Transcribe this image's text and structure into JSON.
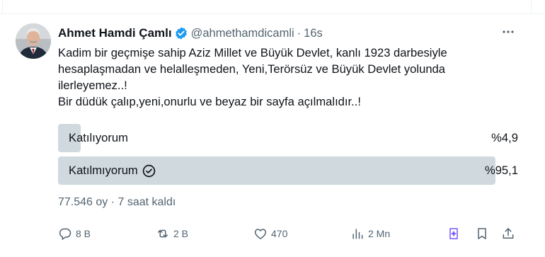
{
  "author": {
    "name": "Ahmet Hamdi Çamlı",
    "handle": "@ahmethamdicamli",
    "separator": "·",
    "time": "16s"
  },
  "tweet_lines": [
    "Kadim bir geçmişe sahip Aziz Millet  ve Büyük Devlet, kanlı 1923 darbesiyle",
    "hesaplaşmadan ve helalleşmeden, Yeni,Terörsüz ve Büyük Devlet yolunda",
    "ilerleyemez..!",
    "Bir düdük çalıp,yeni,onurlu ve beyaz bir sayfa açılmalıdır..!"
  ],
  "poll": {
    "options": [
      {
        "label": "Katılıyorum",
        "percent_text": "%4,9",
        "percent": 4.9,
        "voted": false
      },
      {
        "label": "Katılmıyorum",
        "percent_text": "%95,1",
        "percent": 95.1,
        "voted": true
      }
    ],
    "meta": "77.546 oy · 7 saat kaldı"
  },
  "actions": {
    "reply_count": "8 B",
    "retweet_count": "2 B",
    "like_count": "470",
    "views_count": "2 Mn"
  },
  "colors": {
    "text": "#0f1419",
    "secondary": "#536471",
    "verified": "#1d9bf0",
    "poll_bar": "#cfd9de",
    "grok_icon": "#7856ff"
  },
  "icons": [
    "verified-badge-icon",
    "more-icon",
    "check-circle-icon",
    "reply-icon",
    "retweet-icon",
    "like-icon",
    "views-icon",
    "grok-icon",
    "bookmark-icon",
    "share-icon"
  ]
}
